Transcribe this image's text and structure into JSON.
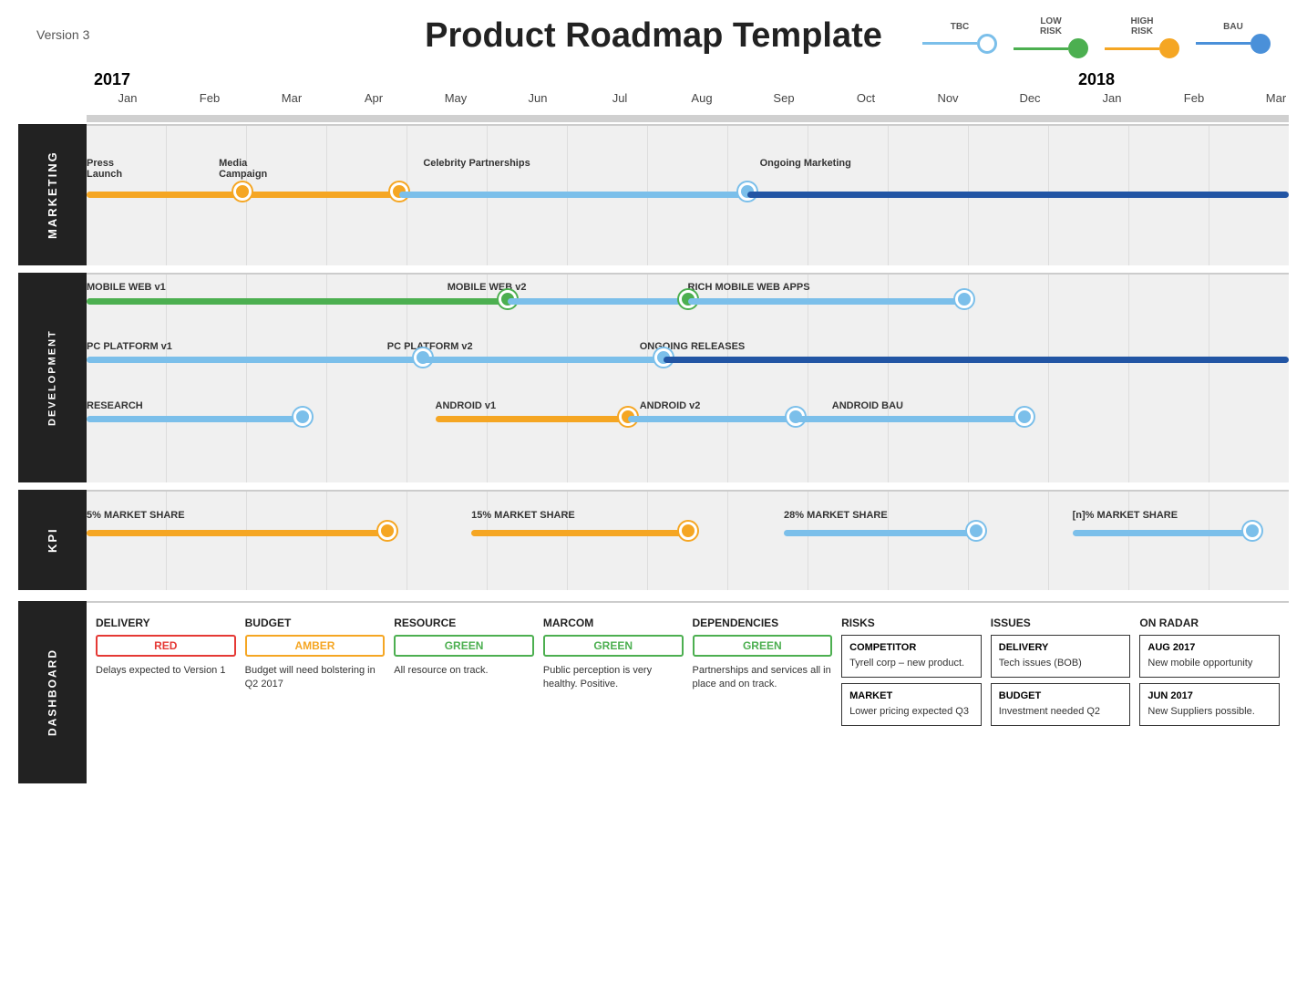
{
  "header": {
    "version": "Version 3",
    "title": "Product Roadmap Template"
  },
  "legend": {
    "items": [
      {
        "id": "tbc",
        "label": "TBC",
        "dot_class": "legend-dot-tbc",
        "line_color": "#7bbfea"
      },
      {
        "id": "low-risk",
        "label1": "LOW",
        "label2": "RISK",
        "dot_class": "legend-dot-low",
        "line_color": "#4caf50"
      },
      {
        "id": "high-risk",
        "label1": "HIGH",
        "label2": "RISK",
        "dot_class": "legend-dot-high",
        "line_color": "#f5a623"
      },
      {
        "id": "bau",
        "label": "BAU",
        "dot_class": "legend-dot-bau",
        "line_color": "#4a90d9"
      }
    ]
  },
  "timeline": {
    "years": [
      {
        "label": "2017",
        "months": [
          "Jan",
          "Feb",
          "Mar",
          "Apr",
          "May",
          "Jun",
          "Jul",
          "Aug",
          "Sep",
          "Oct",
          "Nov",
          "Dec"
        ]
      },
      {
        "label": "2018",
        "months": [
          "Jan",
          "Feb",
          "Mar"
        ]
      }
    ]
  },
  "sections": {
    "marketing": {
      "label": "MARKETING",
      "tracks": [
        {
          "label": "Press Launch",
          "label2": "",
          "bar_color": "orange",
          "bar_start_pct": 0,
          "bar_end_pct": 13,
          "dot1_pct": 13,
          "dot1_color": "orange"
        },
        {
          "label": "Media Campaign",
          "bar_color": "orange",
          "bar_start_pct": 11,
          "bar_end_pct": 26,
          "dot1_pct": 26,
          "dot1_color": "orange"
        },
        {
          "label": "Celebrity Partnerships",
          "bar_color": "light-blue",
          "bar_start_pct": 26,
          "bar_end_pct": 52,
          "dot1_pct": 52,
          "dot1_color": "blue"
        },
        {
          "label": "Ongoing Marketing",
          "bar_color": "dark-blue",
          "bar_start_pct": 52,
          "bar_end_pct": 100
        }
      ]
    },
    "development": {
      "label": "DEVELOPMENT",
      "rows": [
        {
          "label": "MOBILE WEB v1",
          "label2": "MOBILE WEB v2",
          "label3": "RICH MOBILE WEB APPS",
          "bar1_color": "green",
          "bar1_start": 0,
          "bar1_end": 35,
          "dot1": 35,
          "dot1_color": "green",
          "bar2_color": "light-blue",
          "bar2_start": 35,
          "bar2_end": 55,
          "dot2": 55,
          "dot2_color": "green",
          "bar3_color": "light-blue",
          "bar3_start": 55,
          "bar3_end": 75,
          "dot3": 75,
          "dot3_color": "blue"
        },
        {
          "label": "PC PLATFORM v1",
          "label2": "PC PLATFORM v2",
          "label3": "ONGOING RELEASES",
          "bar1_color": "light-blue",
          "bar1_start": 0,
          "bar1_end": 30,
          "dot1": 30,
          "dot1_color": "blue",
          "bar2_color": "light-blue",
          "bar2_start": 30,
          "bar2_end": 50,
          "dot2": 50,
          "dot2_color": "blue",
          "bar3_color": "dark-blue",
          "bar3_start": 50,
          "bar3_end": 100
        },
        {
          "label": "RESEARCH",
          "label2": "ANDROID v1",
          "label3": "ANDROID v2",
          "label4": "ANDROID BAU",
          "bar1_color": "light-blue",
          "bar1_start": 0,
          "bar1_end": 20,
          "dot1": 20,
          "dot1_color": "blue",
          "bar2_color": "orange",
          "bar2_start": 30,
          "bar2_end": 47,
          "dot2": 47,
          "dot2_color": "orange",
          "bar3_color": "light-blue",
          "bar3_start": 47,
          "bar3_end": 60,
          "dot3": 60,
          "dot3_color": "blue",
          "bar4_color": "light-blue",
          "bar4_start": 60,
          "bar4_end": 79,
          "dot4": 79,
          "dot4_color": "blue"
        }
      ]
    },
    "kpi": {
      "label": "KPI",
      "items": [
        {
          "label": "5% MARKET SHARE",
          "start": 0,
          "end": 26,
          "dot_pct": 26,
          "color": "orange"
        },
        {
          "label": "15% MARKET SHARE",
          "start": 34,
          "end": 52,
          "dot_pct": 52,
          "color": "orange"
        },
        {
          "label": "28% MARKET SHARE",
          "start": 60,
          "end": 76,
          "dot_pct": 76,
          "color": "blue"
        },
        {
          "label": "[n]% MARKET SHARE",
          "start": 84,
          "end": 98,
          "dot_pct": 98,
          "color": "blue"
        }
      ]
    },
    "dashboard": {
      "label": "DASHBOARD",
      "cards": [
        {
          "title": "DELIVERY",
          "status": "RED",
          "status_class": "status-red",
          "text": "Delays expected to Version 1"
        },
        {
          "title": "BUDGET",
          "status": "AMBER",
          "status_class": "status-amber",
          "text": "Budget will need bolstering in Q2 2017"
        },
        {
          "title": "RESOURCE",
          "status": "GREEN",
          "status_class": "status-green",
          "text": "All resource on track."
        },
        {
          "title": "MARCOM",
          "status": "GREEN",
          "status_class": "status-green",
          "text": "Public perception is very healthy. Positive."
        },
        {
          "title": "DEPENDENCIES",
          "status": "GREEN",
          "status_class": "status-green",
          "text": "Partnerships and services all in place and on track."
        },
        {
          "title": "RISKS",
          "sub_cards": [
            {
              "title": "COMPETITOR",
              "text": "Tyrell corp – new product."
            },
            {
              "title": "MARKET",
              "text": "Lower pricing expected Q3"
            }
          ]
        },
        {
          "title": "ISSUES",
          "sub_cards": [
            {
              "title": "DELIVERY",
              "text": "Tech issues (BOB)"
            },
            {
              "title": "BUDGET",
              "text": "Investment needed Q2"
            }
          ]
        },
        {
          "title": "ON RADAR",
          "sub_cards": [
            {
              "title": "AUG 2017",
              "text": "New mobile opportunity"
            },
            {
              "title": "JUN 2017",
              "text": "New Suppliers possible."
            }
          ]
        }
      ]
    }
  }
}
